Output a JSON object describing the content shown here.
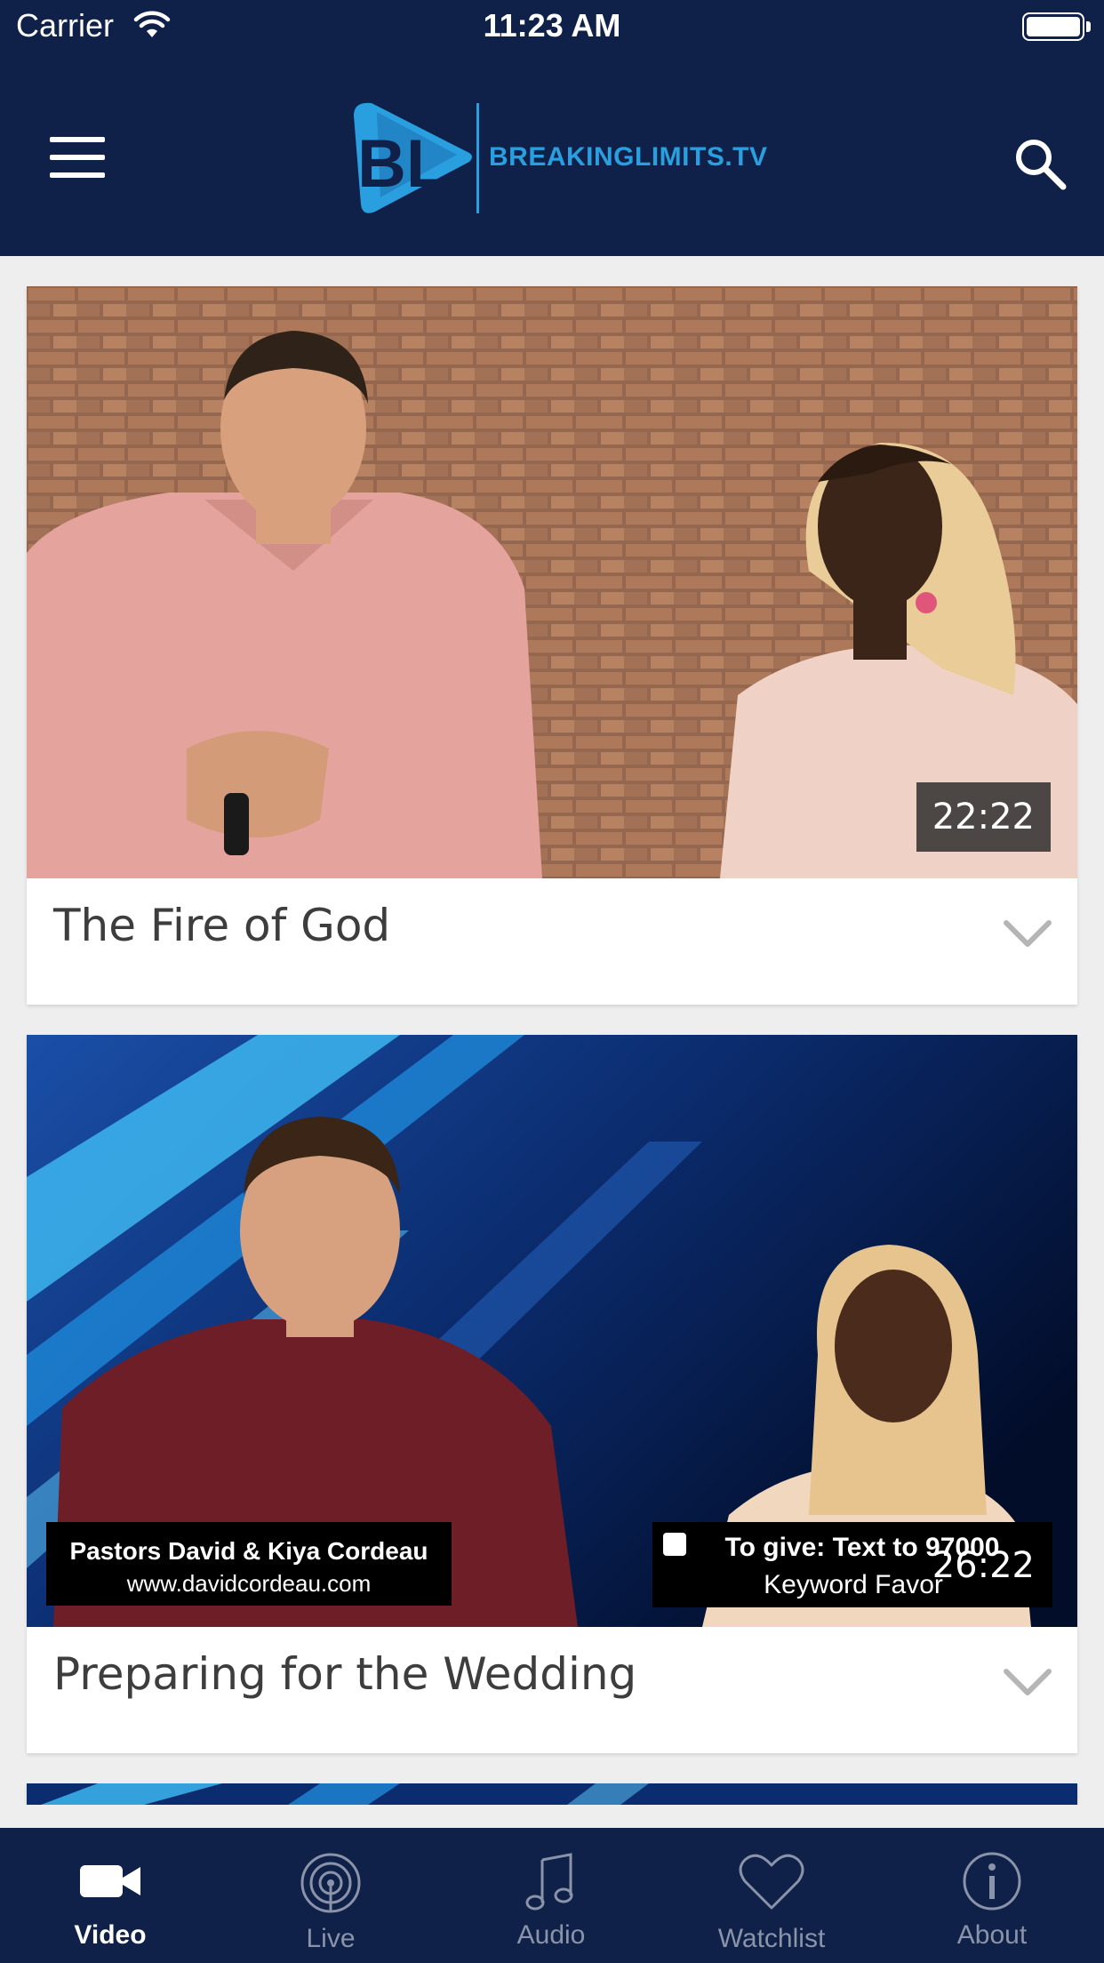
{
  "status_bar": {
    "carrier": "Carrier",
    "time": "11:23 AM"
  },
  "header": {
    "logo_text": "BREAKINGLIMITS.TV",
    "logo_mark": "BL"
  },
  "videos": [
    {
      "title": "The Fire of God",
      "duration": "22:22"
    },
    {
      "title": "Preparing for the Wedding",
      "duration": "26:22",
      "overlay_left": [
        "Pastors David & Kiya Cordeau",
        "www.davidcordeau.com"
      ],
      "overlay_right": [
        "To give: Text to 97000",
        "Keyword Favor"
      ]
    }
  ],
  "tabs": [
    {
      "label": "Video",
      "icon": "video-camera-icon",
      "active": true
    },
    {
      "label": "Live",
      "icon": "live-broadcast-icon",
      "active": false
    },
    {
      "label": "Audio",
      "icon": "music-note-icon",
      "active": false
    },
    {
      "label": "Watchlist",
      "icon": "heart-icon",
      "active": false
    },
    {
      "label": "About",
      "icon": "info-icon",
      "active": false
    }
  ],
  "colors": {
    "header_bg": "#0f2149",
    "accent": "#2a9fe0",
    "page_bg": "#eeeeee",
    "tab_inactive": "#8a93a8"
  }
}
